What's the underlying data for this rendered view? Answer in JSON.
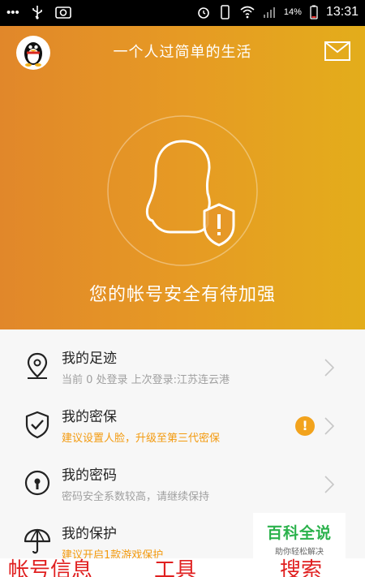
{
  "status_bar": {
    "left_icons": [
      "more-dots",
      "usb-icon",
      "photo-icon"
    ],
    "battery": "14%",
    "time": "13:31"
  },
  "header": {
    "title": "一个人过简单的生活"
  },
  "status_message": "您的帐号安全有待加强",
  "items": [
    {
      "title": "我的足迹",
      "subtitle": "当前 0 处登录  上次登录:江苏连云港",
      "icon": "location-pin-icon"
    },
    {
      "title": "我的密保",
      "subtitle": "建议设置人脸，升级至第三代密保",
      "icon": "shield-check-icon",
      "alert": "!"
    },
    {
      "title": "我的密码",
      "subtitle": "密码安全系数较高，请继续保持",
      "icon": "password-lock-icon"
    },
    {
      "title": "我的保护",
      "subtitle": "建议开启1款游戏保护",
      "icon": "umbrella-icon"
    }
  ],
  "watermark": {
    "main": "百科全说",
    "sub": "助你轻松解决"
  },
  "bottom_tabs": [
    "帐号信息",
    "工具",
    "搜索"
  ],
  "colors": {
    "hero_start": "#e1872a",
    "hero_end": "#e3ad1b",
    "warning": "#f39a0e",
    "alert_badge": "#f2a31d"
  }
}
